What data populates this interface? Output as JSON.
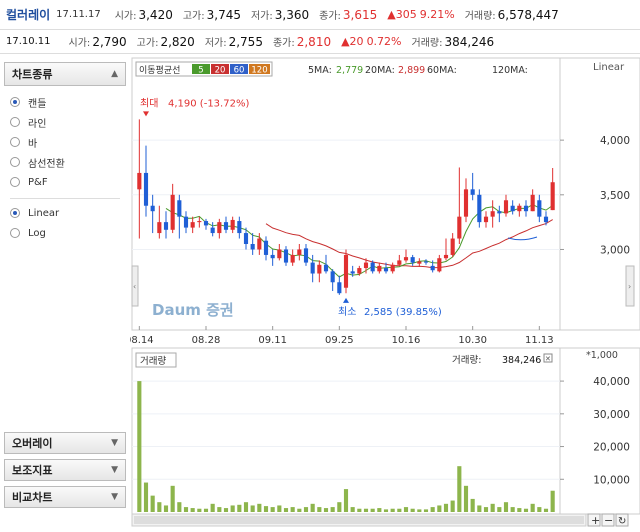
{
  "header": {
    "name": "컬러레이",
    "date": "17.11.17",
    "open_label": "시가:",
    "open": "3,420",
    "high_label": "고가:",
    "high": "3,745",
    "low_label": "저가:",
    "low": "3,360",
    "close_label": "종가:",
    "close": "3,615",
    "change": "▲305",
    "change_pct": "9.21%",
    "volume_label": "거래량:",
    "volume": "6,578,447"
  },
  "subheader": {
    "date": "17.10.11",
    "open_label": "시가:",
    "open": "2,790",
    "high_label": "고가:",
    "high": "2,820",
    "low_label": "저가:",
    "low": "2,755",
    "close_label": "종가:",
    "close": "2,810",
    "change": "▲20",
    "change_pct": "0.72%",
    "volume_label": "거래량:",
    "volume": "384,246"
  },
  "sidebar": {
    "chart_type_title": "차트종류",
    "chart_types": [
      {
        "label": "캔들",
        "selected": true
      },
      {
        "label": "라인",
        "selected": false
      },
      {
        "label": "바",
        "selected": false
      },
      {
        "label": "삼선전환",
        "selected": false
      },
      {
        "label": "P&F",
        "selected": false
      }
    ],
    "scales": [
      {
        "label": "Linear",
        "selected": true
      },
      {
        "label": "Log",
        "selected": false
      }
    ],
    "overlay_label": "오버레이",
    "indicator_label": "보조지표",
    "compare_label": "비교차트"
  },
  "colors": {
    "up": "#e03030",
    "down": "#1f5fd6",
    "ma5": "#4a9a2c",
    "ma20": "#c83030",
    "ma60": "#3060c8",
    "ma120": "#d07820",
    "volume": "#8db54c"
  },
  "chart_data": {
    "type": "candlestick",
    "scale": "Linear",
    "scale_label": "Linear",
    "ma_legend": {
      "title": "이동평균선",
      "periods": [
        "5",
        "20",
        "60",
        "120"
      ]
    },
    "ma_values": {
      "ma5_label": "5MA:",
      "ma5": "2,779",
      "ma20_label": "20MA:",
      "ma20": "2,899",
      "ma60_label": "60MA:",
      "ma120_label": "120MA:"
    },
    "x_ticks": [
      {
        "label": "08.14",
        "index": 0
      },
      {
        "label": "08.28",
        "index": 10
      },
      {
        "label": "09.11",
        "index": 20
      },
      {
        "label": "09.25",
        "index": 30
      },
      {
        "label": "10.16",
        "index": 40
      },
      {
        "label": "10.30",
        "index": 50
      },
      {
        "label": "11.13",
        "index": 60
      }
    ],
    "y_ticks": [
      3000,
      3500,
      4000
    ],
    "y_tick_labels": [
      "3,000",
      "3,500",
      "4,000"
    ],
    "ylim": [
      2300,
      4550
    ],
    "max_annotation": {
      "label": "최대",
      "value": "4,190 (-13.72%)",
      "index": 1,
      "price": 4190
    },
    "min_annotation": {
      "label": "최소",
      "value": "2,585 (39.85%)",
      "index": 31,
      "price": 2585
    },
    "watermark": "Daum 증권",
    "candles": [
      {
        "o": 3550,
        "h": 4190,
        "l": 3100,
        "c": 3700
      },
      {
        "o": 3700,
        "h": 3950,
        "l": 3300,
        "c": 3400
      },
      {
        "o": 3400,
        "h": 3500,
        "l": 3150,
        "c": 3350
      },
      {
        "o": 3150,
        "h": 3400,
        "l": 3100,
        "c": 3250
      },
      {
        "o": 3250,
        "h": 3350,
        "l": 3100,
        "c": 3180
      },
      {
        "o": 3180,
        "h": 3600,
        "l": 3150,
        "c": 3500
      },
      {
        "o": 3450,
        "h": 3500,
        "l": 3100,
        "c": 3300
      },
      {
        "o": 3300,
        "h": 3350,
        "l": 3150,
        "c": 3200
      },
      {
        "o": 3200,
        "h": 3300,
        "l": 3150,
        "c": 3250
      },
      {
        "o": 3250,
        "h": 3300,
        "l": 3200,
        "c": 3260
      },
      {
        "o": 3260,
        "h": 3280,
        "l": 3180,
        "c": 3220
      },
      {
        "o": 3200,
        "h": 3250,
        "l": 3120,
        "c": 3150
      },
      {
        "o": 3150,
        "h": 3280,
        "l": 3100,
        "c": 3250
      },
      {
        "o": 3250,
        "h": 3300,
        "l": 3150,
        "c": 3180
      },
      {
        "o": 3180,
        "h": 3300,
        "l": 3150,
        "c": 3270
      },
      {
        "o": 3260,
        "h": 3300,
        "l": 3100,
        "c": 3150
      },
      {
        "o": 3150,
        "h": 3200,
        "l": 3000,
        "c": 3050
      },
      {
        "o": 3050,
        "h": 3150,
        "l": 2950,
        "c": 3000
      },
      {
        "o": 3000,
        "h": 3150,
        "l": 2950,
        "c": 3100
      },
      {
        "o": 3080,
        "h": 3120,
        "l": 2900,
        "c": 2950
      },
      {
        "o": 2950,
        "h": 3000,
        "l": 2850,
        "c": 2920
      },
      {
        "o": 2920,
        "h": 3050,
        "l": 2900,
        "c": 3000
      },
      {
        "o": 3000,
        "h": 3030,
        "l": 2850,
        "c": 2880
      },
      {
        "o": 2880,
        "h": 3000,
        "l": 2850,
        "c": 2950
      },
      {
        "o": 2950,
        "h": 3050,
        "l": 2900,
        "c": 3000
      },
      {
        "o": 3010,
        "h": 3050,
        "l": 2850,
        "c": 2880
      },
      {
        "o": 2880,
        "h": 2950,
        "l": 2700,
        "c": 2780
      },
      {
        "o": 2780,
        "h": 2900,
        "l": 2700,
        "c": 2860
      },
      {
        "o": 2860,
        "h": 2950,
        "l": 2780,
        "c": 2800
      },
      {
        "o": 2800,
        "h": 2820,
        "l": 2620,
        "c": 2700
      },
      {
        "o": 2700,
        "h": 2760,
        "l": 2585,
        "c": 2600
      },
      {
        "o": 2650,
        "h": 3000,
        "l": 2600,
        "c": 2950
      },
      {
        "o": 2800,
        "h": 2850,
        "l": 2750,
        "c": 2780
      },
      {
        "o": 2780,
        "h": 2850,
        "l": 2760,
        "c": 2830
      },
      {
        "o": 2830,
        "h": 2920,
        "l": 2780,
        "c": 2880
      },
      {
        "o": 2880,
        "h": 2900,
        "l": 2780,
        "c": 2800
      },
      {
        "o": 2800,
        "h": 2880,
        "l": 2780,
        "c": 2850
      },
      {
        "o": 2830,
        "h": 2880,
        "l": 2780,
        "c": 2800
      },
      {
        "o": 2800,
        "h": 2880,
        "l": 2780,
        "c": 2860
      },
      {
        "o": 2860,
        "h": 2950,
        "l": 2850,
        "c": 2900
      },
      {
        "o": 2900,
        "h": 3000,
        "l": 2880,
        "c": 2930
      },
      {
        "o": 2930,
        "h": 2950,
        "l": 2850,
        "c": 2880
      },
      {
        "o": 2870,
        "h": 2920,
        "l": 2840,
        "c": 2890
      },
      {
        "o": 2890,
        "h": 2910,
        "l": 2860,
        "c": 2880
      },
      {
        "o": 2850,
        "h": 2900,
        "l": 2790,
        "c": 2810
      },
      {
        "o": 2800,
        "h": 2950,
        "l": 2790,
        "c": 2920
      },
      {
        "o": 2920,
        "h": 3100,
        "l": 2900,
        "c": 2950
      },
      {
        "o": 2950,
        "h": 3150,
        "l": 2930,
        "c": 3100
      },
      {
        "o": 3100,
        "h": 3750,
        "l": 3050,
        "c": 3300
      },
      {
        "o": 3300,
        "h": 3650,
        "l": 3250,
        "c": 3550
      },
      {
        "o": 3550,
        "h": 3700,
        "l": 3450,
        "c": 3500
      },
      {
        "o": 3500,
        "h": 3550,
        "l": 3200,
        "c": 3250
      },
      {
        "o": 3250,
        "h": 3350,
        "l": 3200,
        "c": 3300
      },
      {
        "o": 3300,
        "h": 3450,
        "l": 3200,
        "c": 3350
      },
      {
        "o": 3350,
        "h": 3400,
        "l": 3250,
        "c": 3330
      },
      {
        "o": 3330,
        "h": 3500,
        "l": 3300,
        "c": 3450
      },
      {
        "o": 3400,
        "h": 3450,
        "l": 3320,
        "c": 3350
      },
      {
        "o": 3350,
        "h": 3420,
        "l": 3300,
        "c": 3400
      },
      {
        "o": 3400,
        "h": 3450,
        "l": 3300,
        "c": 3350
      },
      {
        "o": 3350,
        "h": 3550,
        "l": 3350,
        "c": 3500
      },
      {
        "o": 3450,
        "h": 3500,
        "l": 3250,
        "c": 3300
      },
      {
        "o": 3300,
        "h": 3350,
        "l": 3220,
        "c": 3250
      },
      {
        "o": 3360,
        "h": 3745,
        "l": 3360,
        "c": 3615
      }
    ],
    "volume": {
      "label": "거래량",
      "value_label": "거래량:",
      "value": "384,246",
      "unit": "*1,000",
      "y_ticks": [
        10000,
        20000,
        30000,
        40000
      ],
      "y_tick_labels": [
        "10,000",
        "20,000",
        "30,000",
        "40,000"
      ],
      "ylim": [
        0,
        44000
      ],
      "values": [
        40000,
        9000,
        5000,
        3000,
        2000,
        8000,
        3000,
        1500,
        1200,
        1000,
        1000,
        2500,
        1500,
        1200,
        2000,
        2200,
        3000,
        2000,
        2500,
        1800,
        1500,
        2000,
        1200,
        1500,
        1000,
        1500,
        2500,
        1500,
        1200,
        1500,
        3000,
        7000,
        1500,
        1000,
        1000,
        1000,
        1200,
        800,
        1000,
        1000,
        1500,
        1000,
        800,
        800,
        1500,
        2000,
        2500,
        3500,
        14000,
        8000,
        4000,
        2000,
        1500,
        2500,
        1500,
        3000,
        1500,
        1200,
        1000,
        2500,
        1500,
        1000,
        6500
      ]
    }
  },
  "controls": {
    "zoom_in": "+",
    "zoom_out": "−",
    "reset": "↻"
  }
}
